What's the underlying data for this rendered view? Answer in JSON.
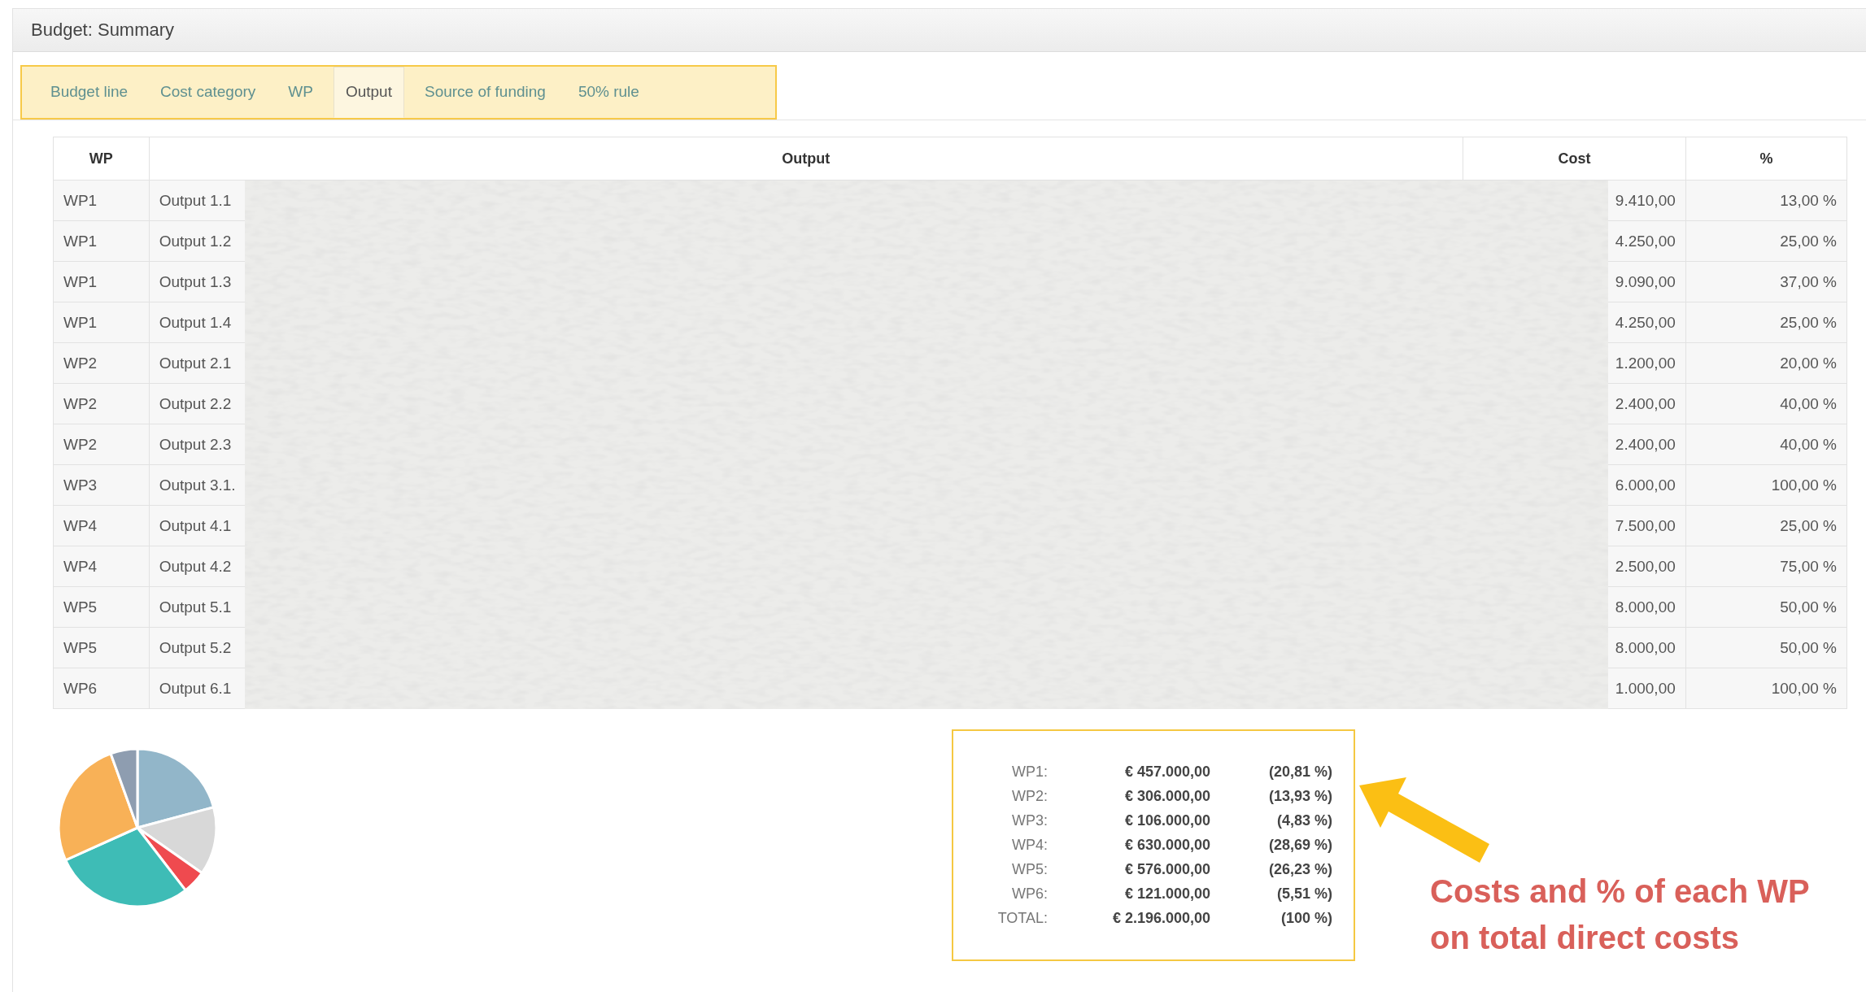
{
  "panel": {
    "title": "Budget: Summary"
  },
  "tabs": [
    {
      "label": "Budget line",
      "selected": false
    },
    {
      "label": "Cost category",
      "selected": false
    },
    {
      "label": "WP",
      "selected": false
    },
    {
      "label": "Output",
      "selected": true
    },
    {
      "label": "Source of funding",
      "selected": false
    },
    {
      "label": "50% rule",
      "selected": false
    }
  ],
  "table": {
    "columns": [
      "WP",
      "Output",
      "Cost",
      "%"
    ],
    "rows": [
      {
        "wp": "WP1",
        "output": "Output 1.1",
        "cost": "9.410,00",
        "percent": "13,00 %"
      },
      {
        "wp": "WP1",
        "output": "Output 1.2",
        "cost": "4.250,00",
        "percent": "25,00 %"
      },
      {
        "wp": "WP1",
        "output": "Output 1.3",
        "cost": "9.090,00",
        "percent": "37,00 %"
      },
      {
        "wp": "WP1",
        "output": "Output 1.4",
        "cost": "4.250,00",
        "percent": "25,00 %"
      },
      {
        "wp": "WP2",
        "output": "Output 2.1",
        "cost": "1.200,00",
        "percent": "20,00 %"
      },
      {
        "wp": "WP2",
        "output": "Output 2.2",
        "cost": "2.400,00",
        "percent": "40,00 %"
      },
      {
        "wp": "WP2",
        "output": "Output 2.3",
        "cost": "2.400,00",
        "percent": "40,00 %"
      },
      {
        "wp": "WP3",
        "output": "Output 3.1.",
        "cost": "6.000,00",
        "percent": "100,00 %"
      },
      {
        "wp": "WP4",
        "output": "Output 4.1",
        "cost": "7.500,00",
        "percent": "25,00 %"
      },
      {
        "wp": "WP4",
        "output": "Output 4.2",
        "cost": "2.500,00",
        "percent": "75,00 %"
      },
      {
        "wp": "WP5",
        "output": "Output 5.1",
        "cost": "8.000,00",
        "percent": "50,00 %"
      },
      {
        "wp": "WP5",
        "output": "Output 5.2",
        "cost": "8.000,00",
        "percent": "50,00 %"
      },
      {
        "wp": "WP6",
        "output": "Output 6.1",
        "cost": "1.000,00",
        "percent": "100,00 %"
      }
    ]
  },
  "summary": [
    {
      "label": "WP1:",
      "amount": "€ 457.000,00",
      "share": "(20,81 %)"
    },
    {
      "label": "WP2:",
      "amount": "€ 306.000,00",
      "share": "(13,93 %)"
    },
    {
      "label": "WP3:",
      "amount": "€ 106.000,00",
      "share": "(4,83 %)"
    },
    {
      "label": "WP4:",
      "amount": "€ 630.000,00",
      "share": "(28,69 %)"
    },
    {
      "label": "WP5:",
      "amount": "€ 576.000,00",
      "share": "(26,23 %)"
    },
    {
      "label": "WP6:",
      "amount": "€ 121.000,00",
      "share": "(5,51 %)"
    },
    {
      "label": "TOTAL:",
      "amount": "€ 2.196.000,00",
      "share": "(100 %)"
    }
  ],
  "annotation": {
    "text": "Costs and % of each WP on total direct costs"
  }
}
